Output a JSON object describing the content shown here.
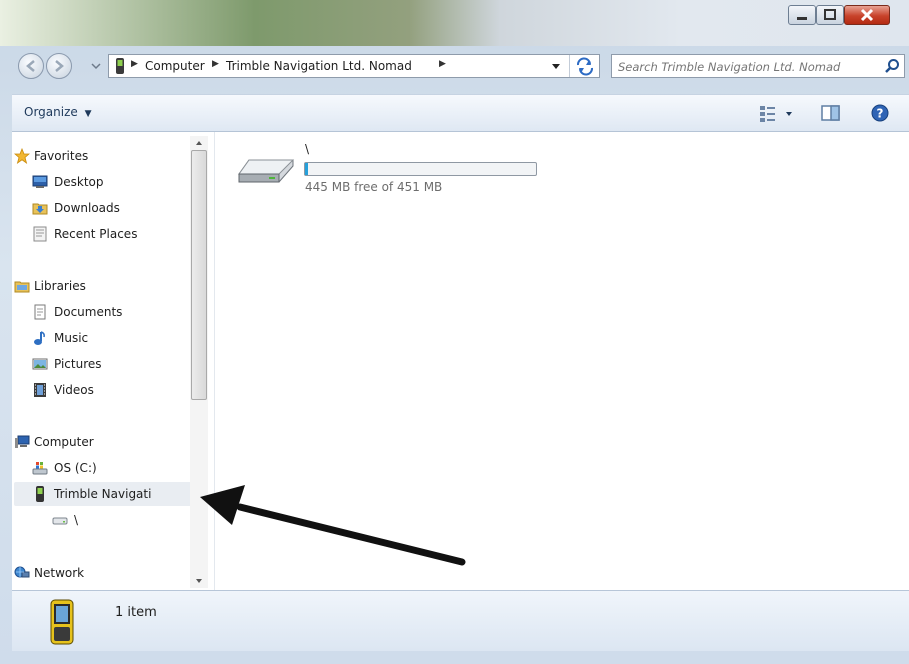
{
  "window": {
    "minimize_icon": "minimize-icon",
    "maximize_icon": "maximize-icon",
    "close_icon": "close-icon"
  },
  "address_bar": {
    "segments": [
      "Computer",
      "Trimble Navigation Ltd. Nomad"
    ]
  },
  "search": {
    "placeholder": "Search Trimble Navigation Ltd. Nomad"
  },
  "toolbar": {
    "organize_label": "Organize"
  },
  "nav": {
    "favorites": {
      "label": "Favorites",
      "items": [
        "Desktop",
        "Downloads",
        "Recent Places"
      ]
    },
    "libraries": {
      "label": "Libraries",
      "items": [
        "Documents",
        "Music",
        "Pictures",
        "Videos"
      ]
    },
    "computer": {
      "label": "Computer",
      "items": [
        "OS (C:)",
        "Trimble Navigati",
        "\\"
      ]
    },
    "network": {
      "label": "Network"
    }
  },
  "content": {
    "drive": {
      "name": "\\",
      "free_text": "445 MB free of 451 MB",
      "used_fraction": 0.013
    }
  },
  "details": {
    "count_text": "1 item"
  },
  "colors": {
    "accent": "#26a0da",
    "selection": "#e5f3fb",
    "annotation_arrow": "#111111"
  }
}
